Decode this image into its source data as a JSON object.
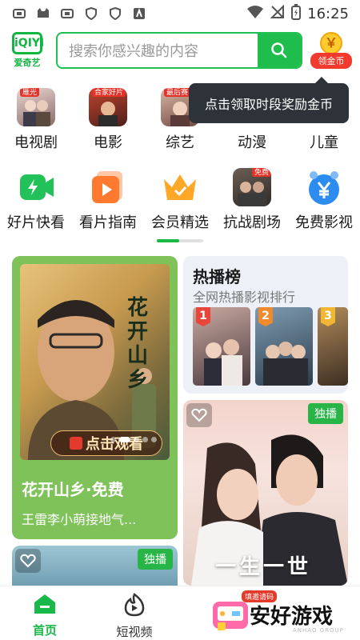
{
  "status_bar": {
    "time": "16:25"
  },
  "header": {
    "logo_mark": "iQIYI",
    "logo_text": "爱奇艺",
    "search_placeholder": "搜索你感兴趣的内容",
    "coin_symbol": "￥",
    "coin_label": "领金币"
  },
  "tooltip": {
    "text": "点击领取时段奖励金币"
  },
  "categories_row1": [
    {
      "label": "电视剧",
      "tag": "雁光"
    },
    {
      "label": "电影",
      "tag": "合家好片"
    },
    {
      "label": "综艺",
      "tag": "最后赛"
    },
    {
      "label": "动漫",
      "tag": ""
    },
    {
      "label": "儿童",
      "tag": ""
    }
  ],
  "categories_row2": [
    {
      "label": "好片快看"
    },
    {
      "label": "看片指南"
    },
    {
      "label": "会员精选"
    },
    {
      "label": "抗战剧场",
      "tag": "免费"
    },
    {
      "label": "免费影视"
    }
  ],
  "feed": {
    "featured": {
      "poster_title": "花开山乡",
      "button": "点击观看",
      "title": "花开山乡·免费",
      "subtitle": "王雷李小萌接地气..."
    },
    "hot_list": {
      "title": "热播榜",
      "subtitle": "全网热播影视排行",
      "ranks": [
        "1",
        "2",
        "3"
      ]
    },
    "drama_card": {
      "badge": "独播",
      "overlay_text": "一生一世"
    },
    "bottom_left_card": {
      "badge": "独播"
    }
  },
  "bottom_nav": {
    "tabs": [
      {
        "label": "首页"
      },
      {
        "label": "短视频"
      }
    ],
    "watermark": {
      "badge": "填邀请码",
      "text": "安好游戏",
      "sub": "ANHAO GROUP"
    }
  },
  "colors": {
    "brand_green": "#1fbd4d",
    "coin_red": "#f13a2d",
    "tooltip_bg": "#2d3338"
  }
}
